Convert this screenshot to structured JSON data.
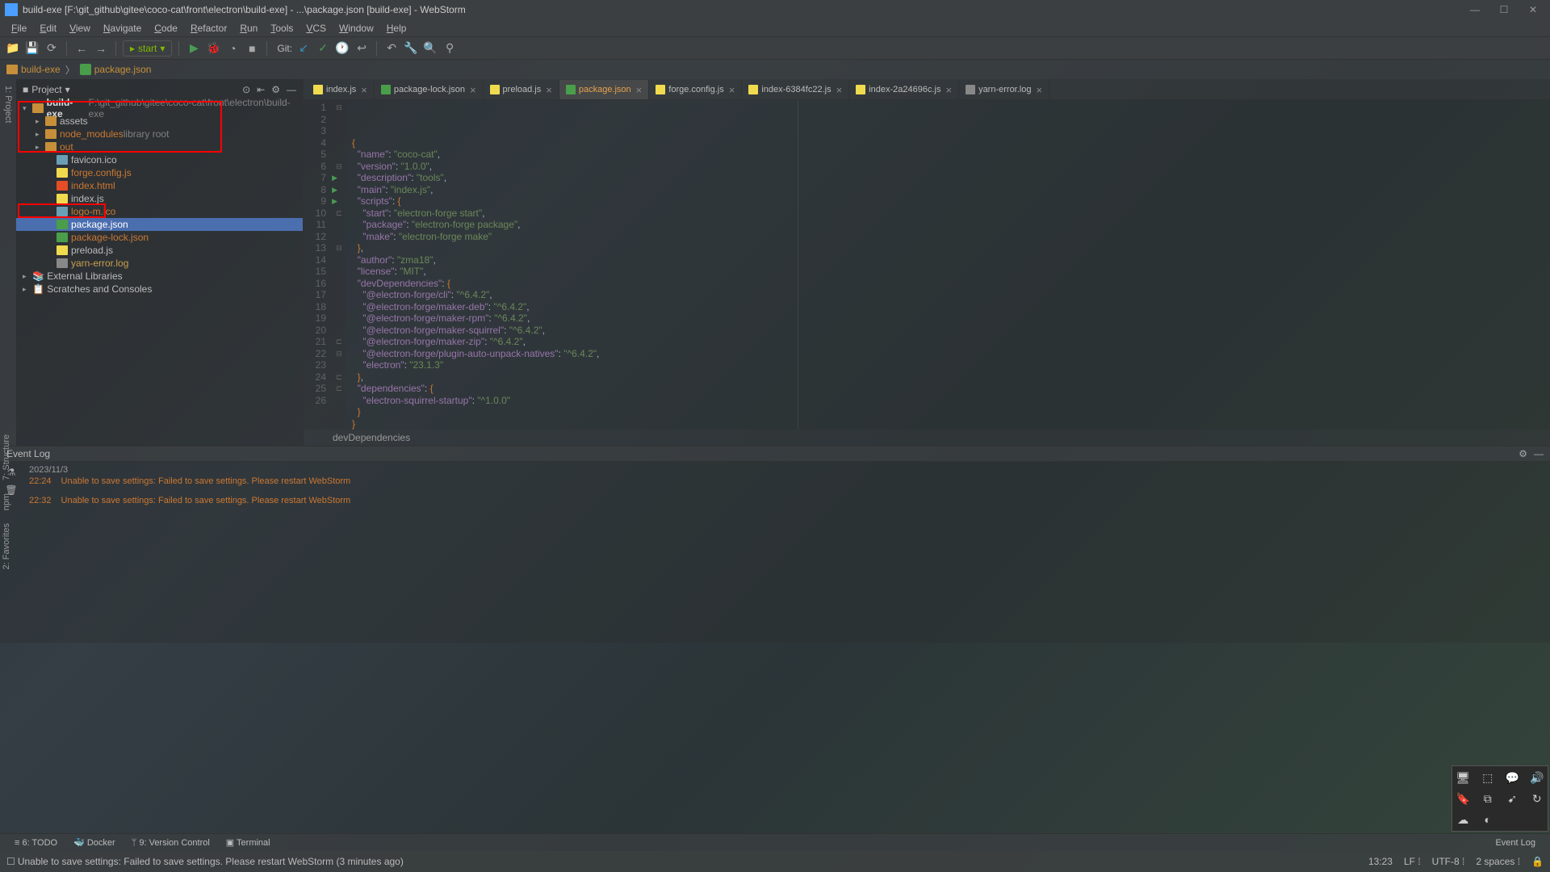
{
  "window": {
    "title": "build-exe [F:\\git_github\\gitee\\coco-cat\\front\\electron\\build-exe] - ...\\package.json [build-exe] - WebStorm"
  },
  "menu": [
    "File",
    "Edit",
    "View",
    "Navigate",
    "Code",
    "Refactor",
    "Run",
    "Tools",
    "VCS",
    "Window",
    "Help"
  ],
  "run_config": "start",
  "git_label": "Git:",
  "breadcrumb": {
    "root": "build-exe",
    "file": "package.json"
  },
  "project": {
    "label": "Project",
    "tree": {
      "root": "build-exe",
      "root_path": "F:\\git_github\\gitee\\coco-cat\\front\\electron\\build-exe",
      "folders": [
        {
          "name": "assets"
        },
        {
          "name": "node_modules",
          "suffix": "library root",
          "dim": true
        },
        {
          "name": "out",
          "highlight": true
        }
      ],
      "files": [
        {
          "name": "favicon.ico",
          "cls": "file-ico"
        },
        {
          "name": "forge.config.js",
          "cls": "file-js",
          "highlight": true
        },
        {
          "name": "index.html",
          "cls": "file-html",
          "highlight": true
        },
        {
          "name": "index.js",
          "cls": "file-js"
        },
        {
          "name": "logo-m.ico",
          "cls": "file-ico",
          "highlight": true
        },
        {
          "name": "package.json",
          "cls": "file-json",
          "selected": true
        },
        {
          "name": "package-lock.json",
          "cls": "file-json",
          "highlight": true
        },
        {
          "name": "preload.js",
          "cls": "file-js"
        },
        {
          "name": "yarn-error.log",
          "cls": "file-log",
          "yellow": true
        }
      ],
      "external": "External Libraries",
      "scratches": "Scratches and Consoles"
    }
  },
  "tabs": [
    {
      "label": "index.js",
      "cls": "file-js"
    },
    {
      "label": "package-lock.json",
      "cls": "file-json"
    },
    {
      "label": "preload.js",
      "cls": "file-js"
    },
    {
      "label": "package.json",
      "cls": "file-json",
      "active": true
    },
    {
      "label": "forge.config.js",
      "cls": "file-js"
    },
    {
      "label": "index-6384fc22.js",
      "cls": "file-js"
    },
    {
      "label": "index-2a24696c.js",
      "cls": "file-js"
    },
    {
      "label": "yarn-error.log",
      "cls": "file-log"
    }
  ],
  "code_lines": [
    "{",
    "  \"name\": \"coco-cat\",",
    "  \"version\": \"1.0.0\",",
    "  \"description\": \"tools\",",
    "  \"main\": \"index.js\",",
    "  \"scripts\": {",
    "    \"start\": \"electron-forge start\",",
    "    \"package\": \"electron-forge package\",",
    "    \"make\": \"electron-forge make\"",
    "  },",
    "  \"author\": \"zma18\",",
    "  \"license\": \"MIT\",",
    "  \"devDependencies\": {",
    "    \"@electron-forge/cli\": \"^6.4.2\",",
    "    \"@electron-forge/maker-deb\": \"^6.4.2\",",
    "    \"@electron-forge/maker-rpm\": \"^6.4.2\",",
    "    \"@electron-forge/maker-squirrel\": \"^6.4.2\",",
    "    \"@electron-forge/maker-zip\": \"^6.4.2\",",
    "    \"@electron-forge/plugin-auto-unpack-natives\": \"^6.4.2\",",
    "    \"electron\": \"23.1.3\"",
    "  },",
    "  \"dependencies\": {",
    "    \"electron-squirrel-startup\": \"^1.0.0\"",
    "  }",
    "}",
    ""
  ],
  "breadcrumb_code": "devDependencies",
  "event_log": {
    "title": "Event Log",
    "date": "2023/11/3",
    "entries": [
      {
        "time": "22:24",
        "msg": "Unable to save settings: Failed to save settings. Please restart WebStorm"
      },
      {
        "time": "22:32",
        "msg": "Unable to save settings: Failed to save settings. Please restart WebStorm"
      }
    ]
  },
  "bottom_tools": [
    {
      "label": "≡ 6: TODO"
    },
    {
      "label": "🐳 Docker"
    },
    {
      "label": "ᛘ 9: Version Control"
    },
    {
      "label": "▣ Terminal"
    }
  ],
  "bottom_right": "Event Log",
  "status": {
    "msg": "Unable to save settings: Failed to save settings. Please restart WebStorm (3 minutes ago)",
    "pos": "13:23",
    "lf": "LF",
    "enc": "UTF-8",
    "indent": "2 spaces",
    "lock": "🔒"
  },
  "left_tools": [
    "7: Structure",
    "npm",
    "2: Favorites"
  ]
}
